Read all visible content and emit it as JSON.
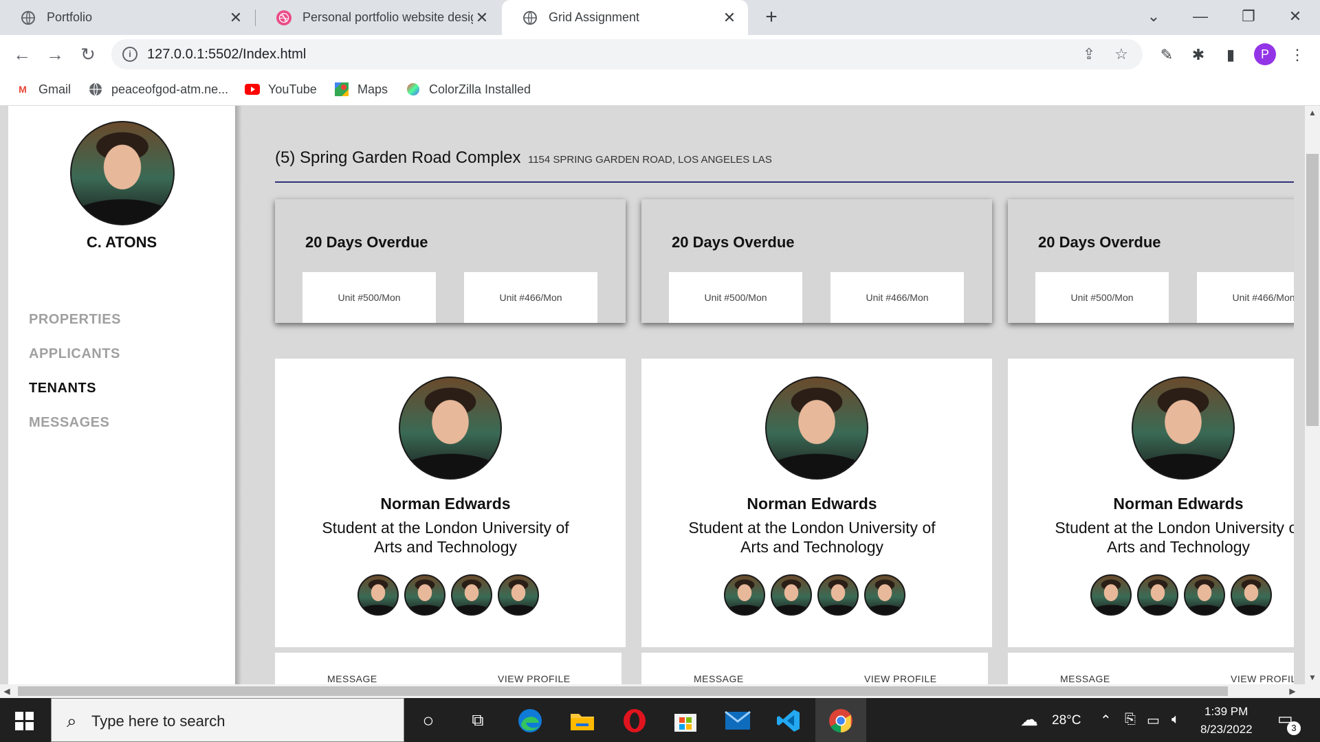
{
  "browser": {
    "tabs": [
      {
        "title": "Portfolio",
        "active": false
      },
      {
        "title": "Personal portfolio website design",
        "active": false
      },
      {
        "title": "Grid Assignment",
        "active": true
      }
    ],
    "url": "127.0.0.1:5502/Index.html",
    "profile_initial": "P",
    "bookmarks": [
      {
        "label": "Gmail",
        "icon": "gmail-icon"
      },
      {
        "label": "peaceofgod-atm.ne...",
        "icon": "globe-icon"
      },
      {
        "label": "YouTube",
        "icon": "youtube-icon"
      },
      {
        "label": "Maps",
        "icon": "maps-icon"
      },
      {
        "label": "ColorZilla Installed",
        "icon": "colorzilla-icon"
      }
    ]
  },
  "sidebar": {
    "user_name": "C. ATONS",
    "nav": [
      {
        "label": "PROPERTIES",
        "active": false
      },
      {
        "label": "APPLICANTS",
        "active": false
      },
      {
        "label": "TENANTS",
        "active": true
      },
      {
        "label": "MESSAGES",
        "active": false
      }
    ]
  },
  "main": {
    "section_title": "(5) Spring Garden Road Complex",
    "section_address": "1154 SPRING GARDEN ROAD, LOS ANGELES LAS",
    "overdue_cards": [
      {
        "title": "20 Days Overdue",
        "units": [
          "Unit #500/Mon",
          "Unit #466/Mon"
        ]
      },
      {
        "title": "20 Days Overdue",
        "units": [
          "Unit #500/Mon",
          "Unit #466/Mon"
        ]
      },
      {
        "title": "20 Days Overdue",
        "units": [
          "Unit #500/Mon",
          "Unit #466/Mon"
        ]
      }
    ],
    "profiles": [
      {
        "name": "Norman Edwards",
        "description": "Student at the London University of Arts and Technology",
        "message": "MESSAGE",
        "view_profile": "VIEW PROFILE"
      },
      {
        "name": "Norman Edwards",
        "description": "Student at the London University of Arts and Technology",
        "message": "MESSAGE",
        "view_profile": "VIEW PROFILE"
      },
      {
        "name": "Norman Edwards",
        "description": "Student at the London University of Arts and Technology",
        "message": "MESSAGE",
        "view_profile": "VIEW PROFILE"
      }
    ]
  },
  "taskbar": {
    "search_placeholder": "Type here to search",
    "temperature": "28°C",
    "time": "1:39 PM",
    "date": "8/23/2022",
    "notification_count": "3"
  },
  "colors": {
    "section_underline": "#30307a",
    "profile_badge": "#9334e6",
    "page_background": "#d9d9d9"
  }
}
